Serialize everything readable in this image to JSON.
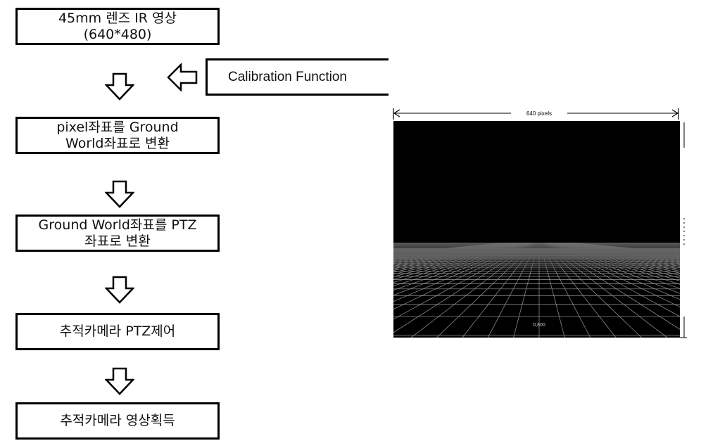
{
  "flowchart": {
    "steps": [
      {
        "lines": [
          "45mm 렌즈 IR 영상",
          "(640*480)"
        ]
      },
      {
        "lines": [
          "pixel좌표를 Ground",
          "World좌표로 변환"
        ]
      },
      {
        "lines": [
          "Ground World좌표를 PTZ",
          "좌표로 변환"
        ]
      },
      {
        "lines": [
          "추적카메라 PTZ제어"
        ]
      },
      {
        "lines": [
          "추적카메라 영상획득"
        ]
      }
    ],
    "side_input": {
      "label": "Calibration Function"
    },
    "arrow_icon": "down-arrow-icon",
    "side_arrow_icon": "left-arrow-icon"
  },
  "ir_image": {
    "width_label": "640 pixels",
    "center_label": "0,800",
    "background": "#000000",
    "grid_color": "#9a9a9a"
  }
}
